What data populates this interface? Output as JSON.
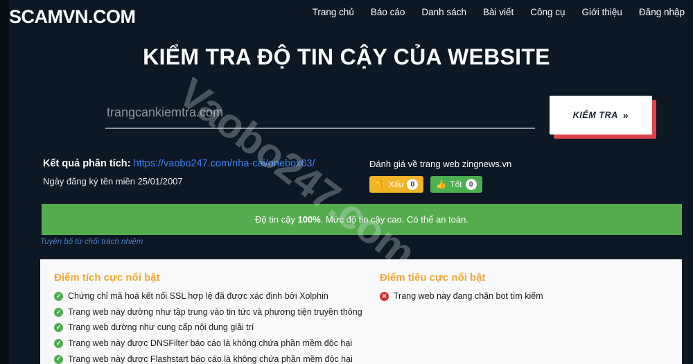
{
  "header": {
    "brand": "SCAMVN.COM",
    "nav": [
      {
        "label": "Trang chủ"
      },
      {
        "label": "Báo cáo"
      },
      {
        "label": "Danh sách"
      },
      {
        "label": "Bài viết"
      },
      {
        "label": "Công cụ"
      },
      {
        "label": "Giới thiệu"
      },
      {
        "label": "Đăng nhập"
      }
    ]
  },
  "hero": {
    "title": "KIỂM TRA ĐỘ TIN CẬY CỦA WEBSITE",
    "search_placeholder": "trangcankiemtra.com",
    "search_value": "",
    "check_button": "KIỂM TRA",
    "check_button_chevron": "»"
  },
  "result": {
    "label": "Kết quả phân tích:",
    "url": "https://vaobo247.com/nha-cai/onebox63/",
    "domain_age": "Ngày đăng ký tên miền 25/01/2007"
  },
  "rating": {
    "title": "Đánh giá về trang web zingnews.vn",
    "bad": {
      "icon": "thumbs-down-icon",
      "glyph": "👎",
      "label": "Xấu",
      "count": "0"
    },
    "good": {
      "icon": "thumbs-up-icon",
      "glyph": "👍",
      "label": "Tốt",
      "count": "0"
    }
  },
  "trust": {
    "prefix": "Độ tin cậy ",
    "score": "100%",
    "suffix": ". Mức độ tin cậy cao. Có thể an toàn.",
    "bar_color": "#56ab4f"
  },
  "disclaimer": "Tuyên bố từ chối trách nhiệm",
  "panels": {
    "positive": {
      "title": "Điểm tích cực nổi bật",
      "items": [
        "Chứng chỉ mã hoá kết nối SSL hợp lệ đã được xác định bởi Xolphin",
        "Trang web này dường như tập trung vào tin tức và phương tiện truyền thông",
        "Trang web dường như cung cấp nội dung giải trí",
        "Trang web này được DNSFilter báo cáo là không chứa phần mềm độc hại",
        "Trang web này được Flashstart báo cáo là không chứa phần mềm độc hại"
      ]
    },
    "negative": {
      "title": "Điểm tiêu cực nổi bật",
      "items": [
        "Trang web này đang chặn bot tìm kiếm"
      ]
    }
  },
  "watermark": "Vaobo247.com",
  "icons": {
    "check": "✓",
    "cross": "✕"
  }
}
